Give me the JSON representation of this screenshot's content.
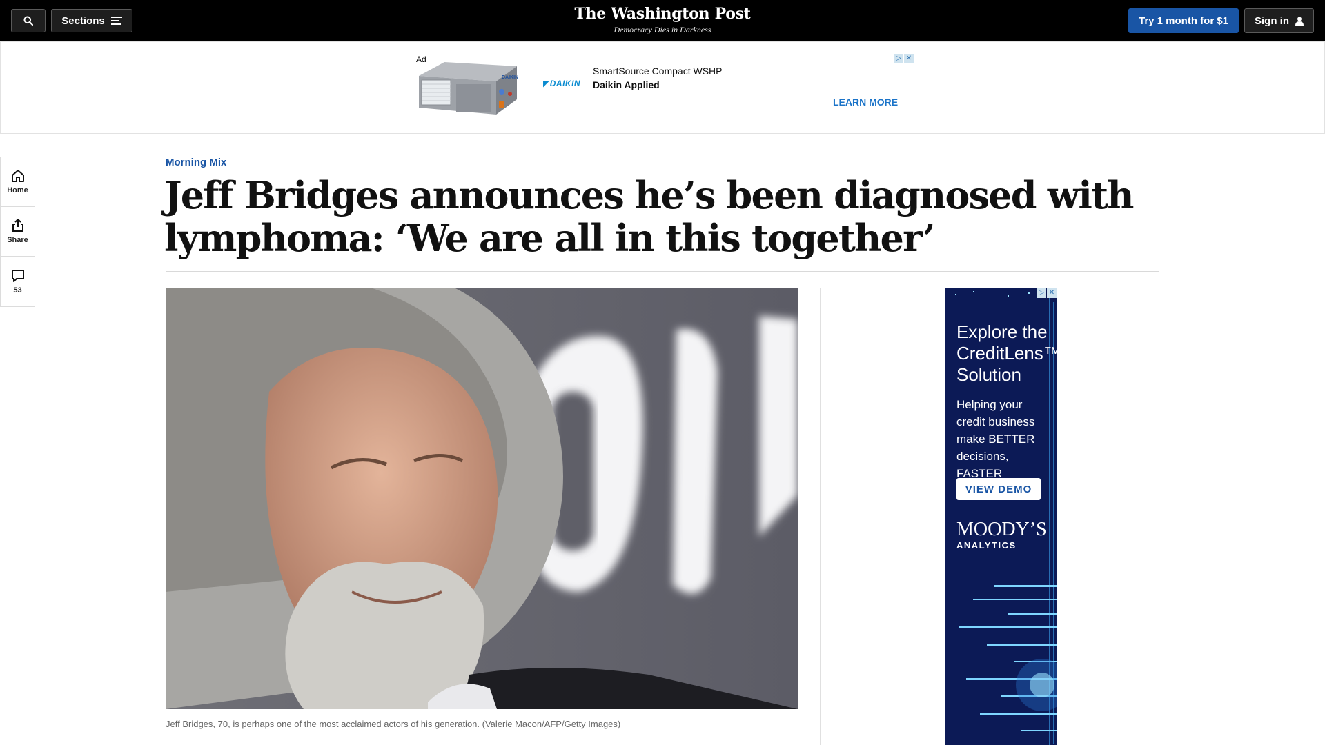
{
  "header": {
    "sections_label": "Sections",
    "brand_name": "The Washington Post",
    "brand_tagline": "Democracy Dies in Darkness",
    "try_label": "Try 1 month for $1",
    "signin_label": "Sign in"
  },
  "top_ad": {
    "ad_label": "Ad",
    "product_title": "SmartSource Compact WSHP",
    "advertiser": "Daikin Applied",
    "logo_text": "DAIKIN",
    "cta": "LEARN MORE"
  },
  "rail": {
    "home_label": "Home",
    "share_label": "Share",
    "comments_count": "53"
  },
  "article": {
    "kicker": "Morning Mix",
    "headline": "Jeff Bridges announces he’s been diagnosed with lymphoma: ‘We are all in this together’",
    "caption": "Jeff Bridges, 70, is perhaps one of the most acclaimed actors of his generation. (Valerie Macon/AFP/Getty Images)"
  },
  "side_ad": {
    "title": "Explore the CreditLens™ Solution",
    "body": "Helping your credit business make BETTER decisions, FASTER",
    "cta": "VIEW DEMO",
    "brand": "MOODY’S",
    "brand_sub": "ANALYTICS"
  },
  "colors": {
    "nav_background": "#000000",
    "accent_blue": "#1955a5",
    "ad_link": "#1a73c8"
  }
}
